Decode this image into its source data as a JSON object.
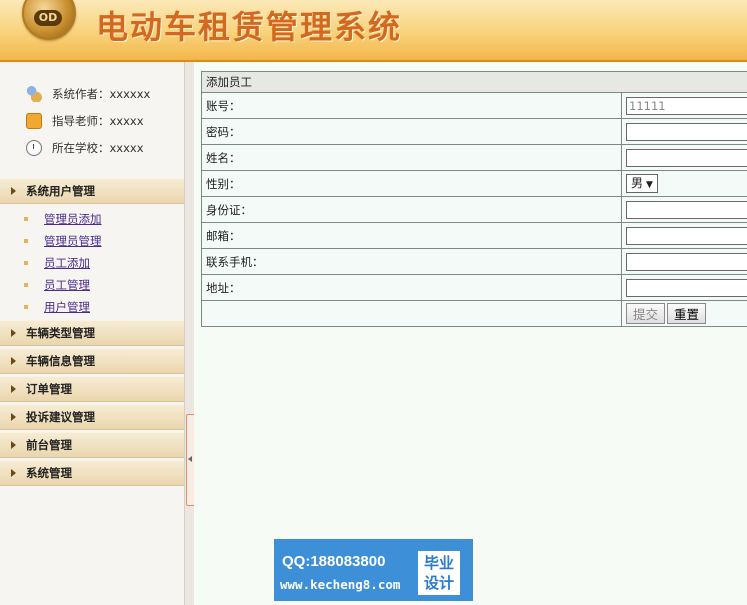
{
  "header": {
    "title": "电动车租赁管理系统",
    "logo_text": "OD"
  },
  "sidebar": {
    "info": [
      {
        "label": "系统作者：xxxxxx",
        "icon": "people-icon"
      },
      {
        "label": "指导老师：xxxxx",
        "icon": "teacher-icon"
      },
      {
        "label": "所在学校：xxxxx",
        "icon": "clock-icon"
      }
    ],
    "groups": [
      {
        "label": "系统用户管理",
        "items": [
          "管理员添加",
          "管理员管理",
          "员工添加",
          "员工管理",
          "用户管理"
        ]
      },
      {
        "label": "车辆类型管理"
      },
      {
        "label": "车辆信息管理"
      },
      {
        "label": "订单管理"
      },
      {
        "label": "投诉建议管理"
      },
      {
        "label": "前台管理"
      },
      {
        "label": "系统管理"
      }
    ]
  },
  "form": {
    "title": "添加员工",
    "rows": [
      {
        "label": "账号：",
        "value": "11111"
      },
      {
        "label": "密码：",
        "value": ""
      },
      {
        "label": "姓名：",
        "value": ""
      },
      {
        "label": "性别：",
        "select": "男"
      },
      {
        "label": "身份证：",
        "value": ""
      },
      {
        "label": "邮箱：",
        "value": ""
      },
      {
        "label": "联系手机：",
        "value": ""
      },
      {
        "label": "地址：",
        "value": ""
      }
    ],
    "submit_label": "提交",
    "reset_label": "重置"
  },
  "watermark": {
    "qq": "QQ:188083800",
    "url": "www.kecheng8.com",
    "badge_line1": "毕业",
    "badge_line2": "设计"
  }
}
